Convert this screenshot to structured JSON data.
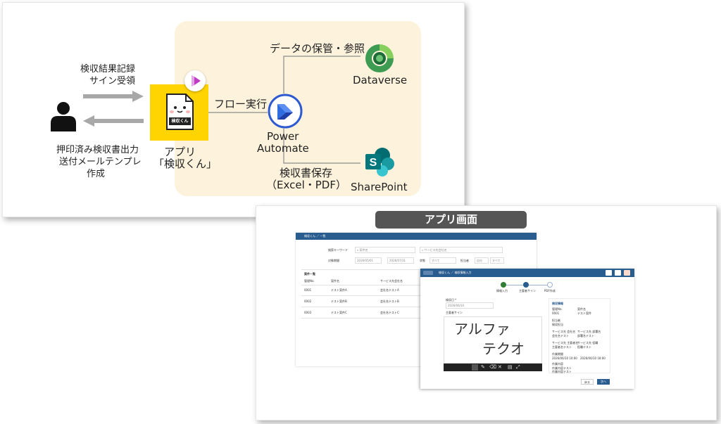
{
  "diagram": {
    "left_top_label": [
      "検収結果記録",
      "サイン受領"
    ],
    "left_bottom_label": [
      "押印済み検収書出力",
      "送付メールテンプレ",
      "作成"
    ],
    "app_label": [
      "アプリ",
      "「検収くん」"
    ],
    "app_tile_text": "検収くん",
    "flow_label": "フロー実行",
    "power_automate_label": [
      "Power",
      "Automate"
    ],
    "dataverse_label": "Dataverse",
    "dataverse_edge_label": "データの保管・参照",
    "sharepoint_label": "SharePoint",
    "sharepoint_edge_label": [
      "検収書保存",
      "（Excel・PDF）"
    ],
    "colors": {
      "beige": "#fdf3dc",
      "app_yellow": "#ffd400",
      "arrow_gray": "#a8a8a8",
      "pa_blue": "#2f5bd1"
    },
    "icons": [
      "person-icon",
      "power-apps-icon",
      "power-automate-icon",
      "dataverse-icon",
      "sharepoint-icon"
    ]
  },
  "app_screen": {
    "title": "アプリ画面",
    "list_window": {
      "breadcrumb": "検収くん ／ 一覧",
      "search_keyword_label": "検索キーワード",
      "search_placeholder": "案件名",
      "service_placeholder": "サービス先会社名",
      "target_period_label": "対象期間",
      "date_from": "2026/05/01",
      "date_to": "2026/07/31",
      "status_label": "状態",
      "status_value": "すべて",
      "sort_label": "担当者",
      "sort_value": "自分",
      "sort_value2": "すべて",
      "list_title": "案件一覧",
      "columns": [
        "管理No.",
        "案件名",
        "サービス先会社名"
      ],
      "rows": [
        [
          "0001",
          "テスト案件A",
          "会社名テストA"
        ],
        [
          "0002",
          "テスト案件B",
          "会社名テストB"
        ],
        [
          "0003",
          "テスト案件C",
          "会社名テストC"
        ]
      ]
    },
    "detail_window": {
      "breadcrumb": "検収くん ／ 検収情報入力",
      "steps": [
        "情報入力",
        "主要者サイン",
        "PDF作成"
      ],
      "date_label": "検収日 *",
      "date_value": "2026/06/10",
      "signature_label": "主要者サイン",
      "signature_lines": [
        "アルファ",
        "テクオ"
      ],
      "info_title": "検収情報",
      "info_fields": [
        [
          "管理No.",
          "案件名"
        ],
        [
          "0001",
          "テスト案件"
        ],
        [
          "担当者",
          ""
        ],
        [
          "検収担当",
          ""
        ],
        [
          "サービス先 会社名",
          "サービス先 部署名"
        ],
        [
          "会社名テスト",
          "部署名テスト"
        ],
        [
          "サービス先 主要者名",
          "サービス先 役職"
        ],
        [
          "主要者名テスト",
          "役職テスト"
        ],
        [
          "作業期間",
          ""
        ],
        [
          "2026/06/10 10:00",
          "2026/06/10 18:00"
        ],
        [
          "作業内容",
          ""
        ],
        [
          "作業内容テスト",
          ""
        ],
        [
          "作業内容テスト",
          ""
        ]
      ],
      "back_button": "戻る",
      "next_button": "次へ"
    }
  }
}
